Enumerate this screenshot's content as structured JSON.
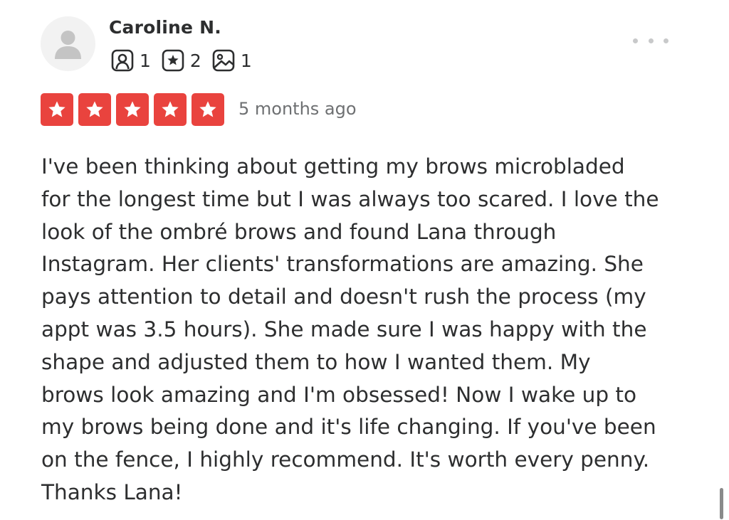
{
  "reviewer": {
    "name": "Caroline N.",
    "avatar_icon": "user-silhouette-icon",
    "stats": [
      {
        "icon": "friends-icon",
        "count": "1"
      },
      {
        "icon": "reviews-icon",
        "count": "2"
      },
      {
        "icon": "photos-icon",
        "count": "1"
      }
    ]
  },
  "menu": {
    "icon": "more-options-icon"
  },
  "rating": {
    "stars": 5,
    "max": 5,
    "color": "#e9433e"
  },
  "date": "5 months ago",
  "review_lines": [
    "I've been thinking about getting my brows microbladed",
    "for the longest time but I was always too scared. I love the",
    "look of the ombré brows and found Lana through",
    "Instagram. Her clients' transformations are amazing. She",
    "pays attention to detail and doesn't rush the process (my",
    "appt was 3.5 hours). She made sure I was happy with the",
    "shape and adjusted them to how I wanted them. My",
    "brows look amazing and I'm obsessed! Now I wake up to",
    "my brows being done and it's life changing. If you've been",
    "on the fence, I highly recommend. It's worth every penny.",
    "Thanks Lana!"
  ]
}
